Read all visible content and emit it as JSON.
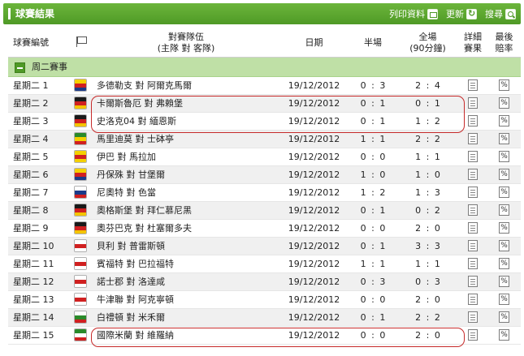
{
  "header": {
    "title": "球賽結果",
    "print_label": "列印資料",
    "refresh_label": "更新",
    "search_label": "搜尋"
  },
  "columns": {
    "match_no": "球賽編號",
    "teams_line1": "對賽隊伍",
    "teams_line2": "(主隊 對 客隊)",
    "date": "日期",
    "half": "半場",
    "full_line1": "全場",
    "full_line2": "(90分鐘)",
    "detail_line1": "詳細",
    "detail_line2": "賽果",
    "odds_line1": "最後",
    "odds_line2": "賠率"
  },
  "group": {
    "label": "周二賽事"
  },
  "icons": {
    "detail": "document-icon",
    "odds": "percent-icon",
    "flag": "flag-icon"
  },
  "odds_symbol": "%",
  "rows": [
    {
      "day": "星期二",
      "no": "1",
      "teams": "多德勒支 對 阿爾克馬爾",
      "date": "19/12/2012",
      "half": "0 : 3",
      "full": "2 : 4",
      "logo": [
        "#f4d000",
        "#d02020",
        "#1b3b8a"
      ]
    },
    {
      "day": "星期二",
      "no": "2",
      "teams": "卡爾斯魯厄 對 弗賴堡",
      "date": "19/12/2012",
      "half": "0 : 1",
      "full": "0 : 1",
      "logo": [
        "#1a1a1a",
        "#d02020",
        "#f4c400"
      ]
    },
    {
      "day": "星期二",
      "no": "3",
      "teams": "史洛克04 對 緬恩斯",
      "date": "19/12/2012",
      "half": "0 : 1",
      "full": "1 : 2",
      "logo": [
        "#1a1a1a",
        "#d02020",
        "#f4c400"
      ]
    },
    {
      "day": "星期二",
      "no": "4",
      "teams": "馬里迪莫 對 士砵亭",
      "date": "19/12/2012",
      "half": "1 : 1",
      "full": "2 : 2",
      "logo": [
        "#2a8a2a",
        "#f4d000",
        "#d02020"
      ]
    },
    {
      "day": "星期二",
      "no": "5",
      "teams": "伊巴 對 馬拉加",
      "date": "19/12/2012",
      "half": "0 : 0",
      "full": "1 : 1",
      "logo": [
        "#f4d000",
        "#d02020",
        "#f4d000"
      ]
    },
    {
      "day": "星期二",
      "no": "6",
      "teams": "丹保殊 對 甘堡爾",
      "date": "19/12/2012",
      "half": "1 : 0",
      "full": "1 : 0",
      "logo": [
        "#f4d000",
        "#d02020",
        "#1b3b8a"
      ]
    },
    {
      "day": "星期二",
      "no": "7",
      "teams": "尼奧特 對 色當",
      "date": "19/12/2012",
      "half": "1 : 2",
      "full": "1 : 3",
      "logo": [
        "#ffffff",
        "#1b3b8a",
        "#d02020"
      ]
    },
    {
      "day": "星期二",
      "no": "8",
      "teams": "奧格斯堡 對 拜仁慕尼黑",
      "date": "19/12/2012",
      "half": "0 : 1",
      "full": "0 : 2",
      "logo": [
        "#1a1a1a",
        "#d02020",
        "#f4c400"
      ]
    },
    {
      "day": "星期二",
      "no": "9",
      "teams": "奧芬巴克 對 杜塞爾多夫",
      "date": "19/12/2012",
      "half": "0 : 0",
      "full": "2 : 0",
      "logo": [
        "#1a1a1a",
        "#d02020",
        "#f4c400"
      ]
    },
    {
      "day": "星期二",
      "no": "10",
      "teams": "貝利 對 普雷斯頓",
      "date": "19/12/2012",
      "half": "0 : 1",
      "full": "3 : 3",
      "logo": [
        "#ffffff",
        "#d02020",
        "#ffffff"
      ]
    },
    {
      "day": "星期二",
      "no": "11",
      "teams": "賓福特 對 巴拉福特",
      "date": "19/12/2012",
      "half": "1 : 1",
      "full": "1 : 1",
      "logo": [
        "#ffffff",
        "#d02020",
        "#ffffff"
      ]
    },
    {
      "day": "星期二",
      "no": "12",
      "teams": "諾士郡 對 洛達咸",
      "date": "19/12/2012",
      "half": "0 : 3",
      "full": "0 : 3",
      "logo": [
        "#ffffff",
        "#d02020",
        "#ffffff"
      ]
    },
    {
      "day": "星期二",
      "no": "13",
      "teams": "牛津聯 對 阿克寧頓",
      "date": "19/12/2012",
      "half": "0 : 0",
      "full": "2 : 0",
      "logo": [
        "#ffffff",
        "#d02020",
        "#ffffff"
      ]
    },
    {
      "day": "星期二",
      "no": "14",
      "teams": "白禮頓 對 米禾爾",
      "date": "19/12/2012",
      "half": "0 : 1",
      "full": "2 : 2",
      "logo": [
        "#ffffff",
        "#2a8a2a",
        "#d02020"
      ]
    },
    {
      "day": "星期二",
      "no": "15",
      "teams": "國際米蘭 對 維羅納",
      "date": "19/12/2012",
      "half": "0 : 0",
      "full": "2 : 0",
      "logo": [
        "#2a8a2a",
        "#ffffff",
        "#d02020"
      ]
    }
  ],
  "highlight_color": "#c62a2a",
  "accent_color": "#5aa72f"
}
